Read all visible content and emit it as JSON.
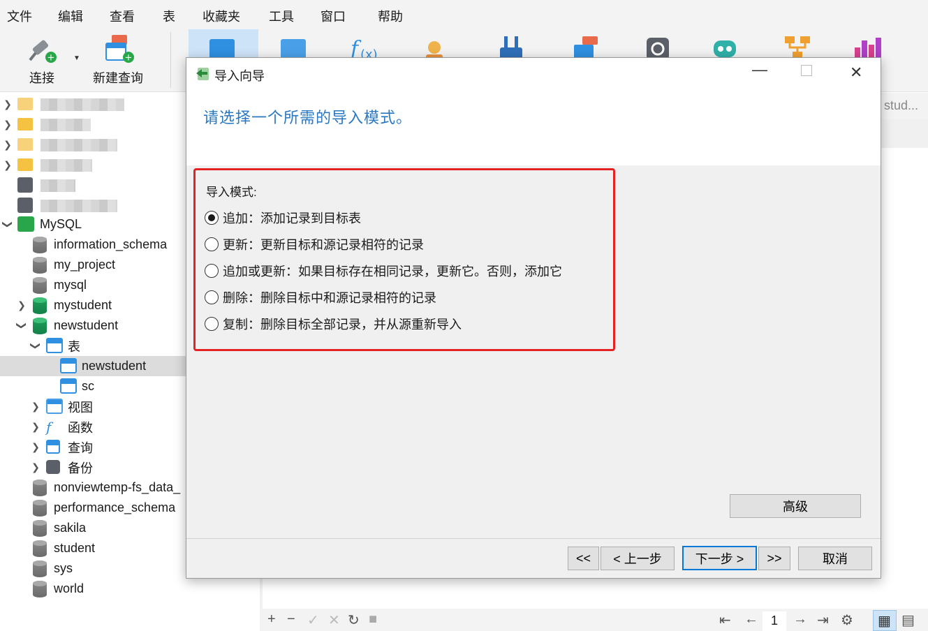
{
  "menu": [
    "文件",
    "编辑",
    "查看",
    "表",
    "收藏夹",
    "工具",
    "窗口",
    "帮助"
  ],
  "toolbar": {
    "connect_label": "连接",
    "new_query_label": "新建查询"
  },
  "tab_partial": "stud...",
  "tree": {
    "mysql_label": "MySQL",
    "databases": [
      "information_schema",
      "my_project",
      "mysql",
      "mystudent",
      "newstudent"
    ],
    "tables_label": "表",
    "tables": [
      "newstudent",
      "sc"
    ],
    "nodes": [
      "视图",
      "函数",
      "查询",
      "备份"
    ],
    "more_databases": [
      "nonviewtemp-fs_data_",
      "performance_schema",
      "sakila",
      "student",
      "sys",
      "world"
    ]
  },
  "dialog": {
    "title": "导入向导",
    "heading": "请选择一个所需的导入模式。",
    "group_label": "导入模式:",
    "options": [
      {
        "label": "追加：添加记录到目标表",
        "selected": true
      },
      {
        "label": "更新：更新目标和源记录相符的记录",
        "selected": false
      },
      {
        "label": "追加或更新：如果目标存在相同记录，更新它。否则，添加它",
        "selected": false
      },
      {
        "label": "删除：删除目标中和源记录相符的记录",
        "selected": false
      },
      {
        "label": "复制：删除目标全部记录，并从源重新导入",
        "selected": false
      }
    ],
    "advanced_label": "高级",
    "first_label": "<<",
    "prev_label": "< 上一步",
    "next_label": "下一步 >",
    "last_label": ">>",
    "cancel_label": "取消"
  },
  "status": {
    "page": "1"
  },
  "colors": {
    "accent": "#2a78c2",
    "highlight_border": "#e52222",
    "default_button_border": "#0078d7"
  }
}
